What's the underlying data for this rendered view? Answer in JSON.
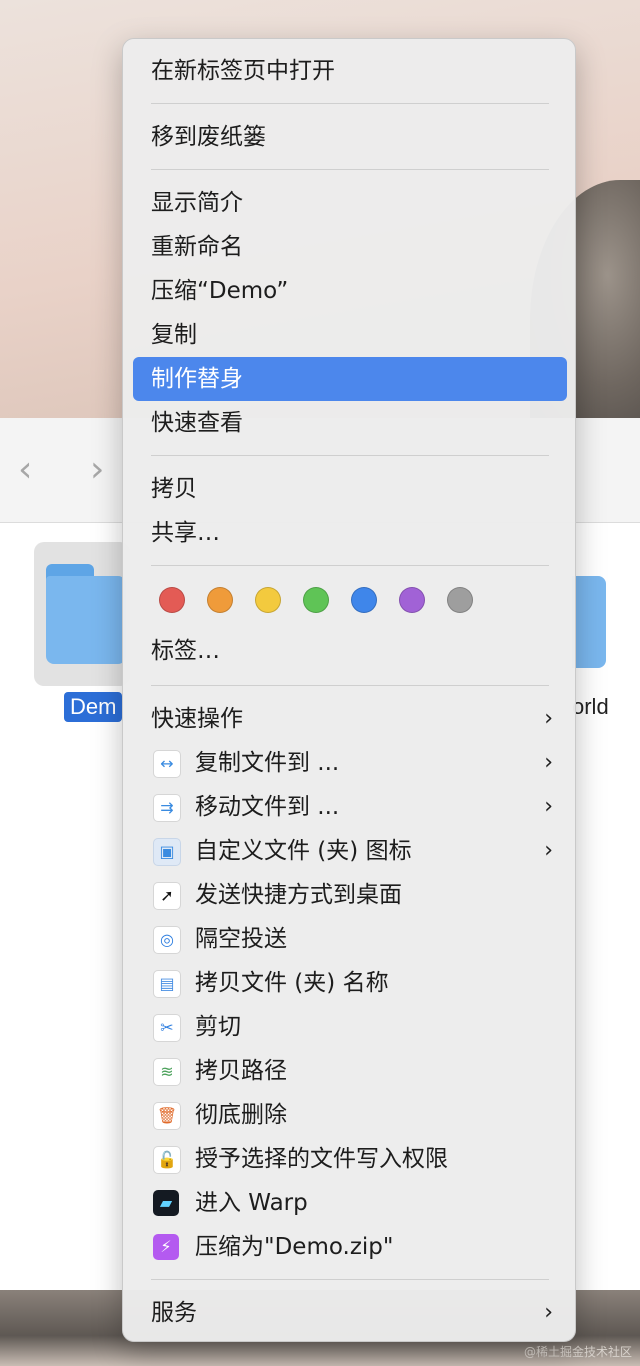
{
  "finder": {
    "folder_name": "Dem",
    "folder2_name": "orld",
    "back_glyph": "‹",
    "forward_glyph": "›"
  },
  "menu": {
    "open_in_new_tab": "在新标签页中打开",
    "move_to_trash": "移到废纸篓",
    "get_info": "显示简介",
    "rename": "重新命名",
    "compress": "压缩“Demo”",
    "duplicate": "复制",
    "make_alias": "制作替身",
    "quick_look": "快速查看",
    "copy": "拷贝",
    "share": "共享…",
    "tags_label": "标签…",
    "quick_actions": "快速操作",
    "copy_file_to": "复制文件到 ...",
    "move_file_to": "移动文件到 ...",
    "custom_icon": "自定义文件 (夹) 图标",
    "send_shortcut": "发送快捷方式到桌面",
    "airdrop": "隔空投送",
    "copy_name": "拷贝文件 (夹) 名称",
    "cut": "剪切",
    "copy_path": "拷贝路径",
    "delete_forever": "彻底删除",
    "grant_permission": "授予选择的文件写入权限",
    "enter_warp": "进入 Warp",
    "compress_zip": "压缩为\"Demo.zip\"",
    "services": "服务",
    "chevron": "›"
  },
  "tag_colors": [
    "#e35b55",
    "#ef9b3a",
    "#f3ca3e",
    "#5fc456",
    "#3f86ea",
    "#a162d6",
    "#9e9e9e"
  ],
  "icons": {
    "copy_file_to": "↔",
    "move_file_to": "⇉",
    "custom_icon": "▣",
    "send_shortcut": "➚",
    "airdrop": "◎",
    "copy_name": "▤",
    "cut": "✂",
    "copy_path": "≋",
    "delete_forever": "🗑",
    "grant_permission": "🔓",
    "enter_warp": "▰",
    "compress_zip": "⚡"
  },
  "watermark": "@稀土掘金技术社区"
}
